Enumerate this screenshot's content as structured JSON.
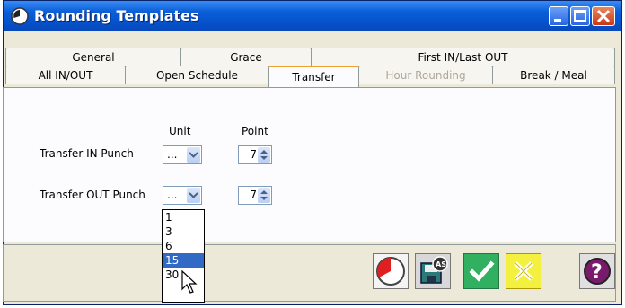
{
  "window": {
    "title": "Rounding Templates"
  },
  "tabs": {
    "row1": [
      "General",
      "Grace",
      "First IN/Last OUT"
    ],
    "row2": [
      "All IN/OUT",
      "Open Schedule",
      "Transfer",
      "Hour Rounding",
      "Break / Meal"
    ]
  },
  "form": {
    "unit_header": "Unit",
    "point_header": "Point",
    "in_label": "Transfer IN Punch",
    "out_label": "Transfer OUT Punch",
    "in_unit": "...",
    "out_unit": "...",
    "in_point": "7",
    "out_point": "7"
  },
  "dropdown": {
    "options": [
      "1",
      "3",
      "6",
      "15",
      "30"
    ],
    "selected": "15"
  },
  "icons": [
    "clock-icon",
    "save-as-icon",
    "ok-check-icon",
    "cancel-x-icon",
    "help-icon"
  ],
  "colors": {
    "titlebar": "#0552cc",
    "accent_tab": "#f0a030",
    "selection": "#316ac5"
  }
}
